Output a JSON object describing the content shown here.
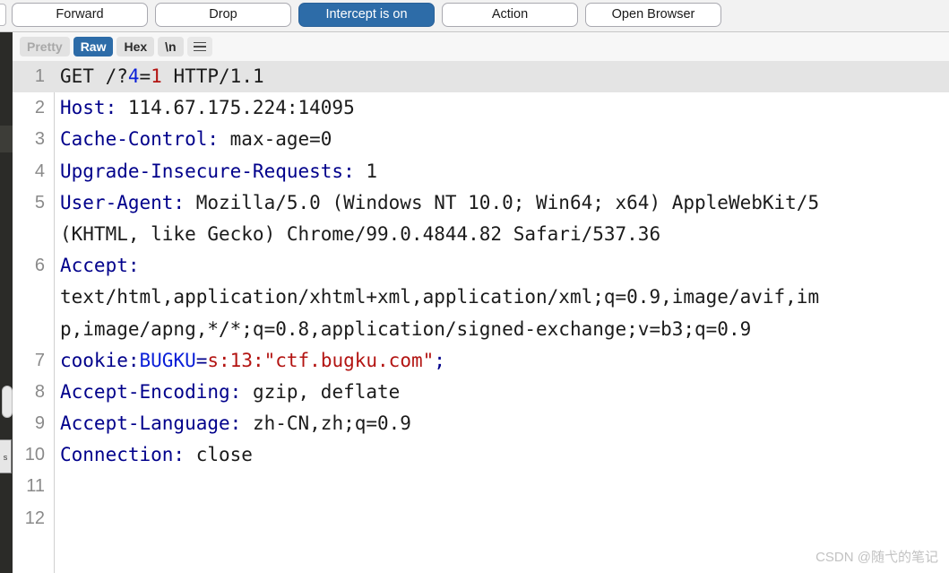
{
  "toolbar": {
    "buttons": [
      {
        "label": "Forward",
        "state": "normal",
        "name": "forward-button"
      },
      {
        "label": "Drop",
        "state": "normal",
        "name": "drop-button"
      },
      {
        "label": "Intercept is on",
        "state": "active",
        "name": "intercept-toggle-button"
      },
      {
        "label": "Action",
        "state": "normal",
        "name": "action-button"
      },
      {
        "label": "Open Browser",
        "state": "normal",
        "name": "open-browser-button"
      }
    ],
    "active_color": "#2d6ca8"
  },
  "format_tabs": {
    "items": [
      {
        "label": "Pretty",
        "state": "disabled"
      },
      {
        "label": "Raw",
        "state": "selected"
      },
      {
        "label": "Hex",
        "state": "normal"
      },
      {
        "label": "\\n",
        "state": "normal"
      }
    ],
    "menu_icon": "hamburger-menu-icon"
  },
  "side_tab": {
    "label": "s"
  },
  "editor": {
    "highlight_color": "#e4e4e4",
    "header_color": "#00008b",
    "value_color": "#1b1b1b",
    "accent_blue": "#0a1fd8",
    "accent_red": "#b31412",
    "lines": [
      {
        "number": "1",
        "highlight": true,
        "segments": [
          {
            "text": "GET /?",
            "cls": ""
          },
          {
            "text": "4",
            "cls": "blue"
          },
          {
            "text": "=",
            "cls": ""
          },
          {
            "text": "1",
            "cls": "red"
          },
          {
            "text": " HTTP/1.1",
            "cls": ""
          }
        ]
      },
      {
        "number": "2",
        "highlight": false,
        "segments": [
          {
            "text": "Host:",
            "cls": "hdr"
          },
          {
            "text": " 114.67.175.224:14095",
            "cls": ""
          }
        ]
      },
      {
        "number": "3",
        "highlight": false,
        "segments": [
          {
            "text": "Cache-Control:",
            "cls": "hdr"
          },
          {
            "text": " max-age=0",
            "cls": ""
          }
        ]
      },
      {
        "number": "4",
        "highlight": false,
        "segments": [
          {
            "text": "Upgrade-Insecure-Requests:",
            "cls": "hdr"
          },
          {
            "text": " 1",
            "cls": ""
          }
        ]
      },
      {
        "number": "5",
        "highlight": false,
        "segments": [
          {
            "text": "User-Agent:",
            "cls": "hdr"
          },
          {
            "text": " Mozilla/5.0 (Windows NT 10.0; Win64; x64) AppleWebKit/5",
            "cls": ""
          }
        ]
      },
      {
        "number": "",
        "highlight": false,
        "segments": [
          {
            "text": "(KHTML, like Gecko) Chrome/99.0.4844.82 Safari/537.36",
            "cls": ""
          }
        ]
      },
      {
        "number": "6",
        "highlight": false,
        "segments": [
          {
            "text": "Accept:",
            "cls": "hdr"
          }
        ]
      },
      {
        "number": "",
        "highlight": false,
        "segments": [
          {
            "text": "text/html,application/xhtml+xml,application/xml;q=0.9,image/avif,im",
            "cls": ""
          }
        ]
      },
      {
        "number": "",
        "highlight": false,
        "segments": [
          {
            "text": "p,image/apng,*/*;q=0.8,application/signed-exchange;v=b3;q=0.9",
            "cls": ""
          }
        ]
      },
      {
        "number": "7",
        "highlight": false,
        "segments": [
          {
            "text": "cookie:",
            "cls": "hdr"
          },
          {
            "text": "BUGKU",
            "cls": "blue"
          },
          {
            "text": "=",
            "cls": "hdr"
          },
          {
            "text": "s:13:\"ctf.bugku.com\"",
            "cls": "red"
          },
          {
            "text": ";",
            "cls": "hdr"
          }
        ]
      },
      {
        "number": "8",
        "highlight": false,
        "segments": [
          {
            "text": "Accept-Encoding:",
            "cls": "hdr"
          },
          {
            "text": " gzip, deflate",
            "cls": ""
          }
        ]
      },
      {
        "number": "9",
        "highlight": false,
        "segments": [
          {
            "text": "Accept-Language:",
            "cls": "hdr"
          },
          {
            "text": " zh-CN,zh;q=0.9",
            "cls": ""
          }
        ]
      },
      {
        "number": "10",
        "highlight": false,
        "segments": [
          {
            "text": "Connection:",
            "cls": "hdr"
          },
          {
            "text": " close",
            "cls": ""
          }
        ]
      },
      {
        "number": "11",
        "highlight": false,
        "segments": []
      },
      {
        "number": "12",
        "highlight": false,
        "segments": []
      }
    ]
  },
  "watermark": {
    "text": "CSDN @随弋的笔记"
  }
}
